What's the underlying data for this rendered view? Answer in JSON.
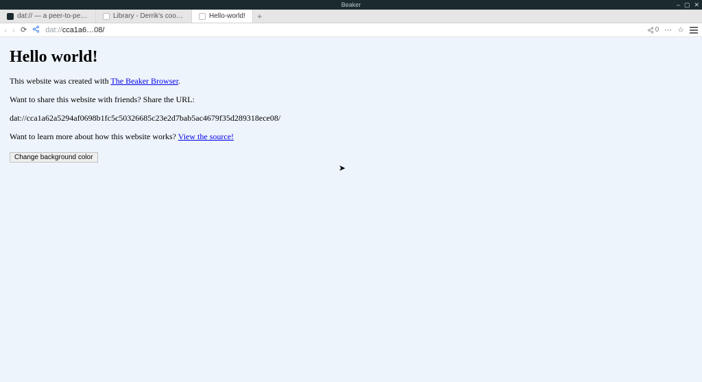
{
  "titlebar": {
    "app_name": "Beaker"
  },
  "tabs": [
    {
      "label": "dat:// — a peer-to-peer protocol",
      "active": false
    },
    {
      "label": "Library - Derrik's cool website thing",
      "active": false
    },
    {
      "label": "Hello-world!",
      "active": true
    }
  ],
  "toolbar": {
    "url_protocol": "dat://",
    "url_path": "cca1a6…08/",
    "peers_count": "0"
  },
  "content": {
    "heading": "Hello world!",
    "p1_before_link": "This website was created with ",
    "p1_link": "The Beaker Browser",
    "p1_after_link": ".",
    "p2": "Want to share this website with friends? Share the URL:",
    "p3_url": "dat://cca1a62a5294af0698b1fc5c50326685c23e2d7bab5ac4679f35d289318ece08/",
    "p4_before_link": "Want to learn more about how this website works? ",
    "p4_link": "View the source!",
    "button_label": "Change background color"
  }
}
